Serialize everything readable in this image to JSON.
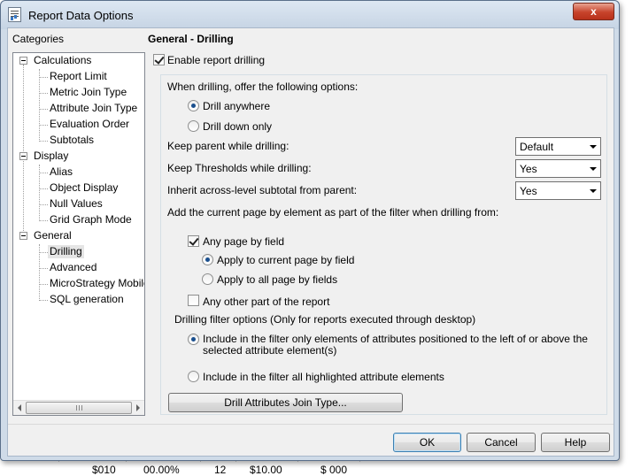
{
  "window": {
    "title": "Report Data Options",
    "close_label": "x"
  },
  "categories": {
    "label": "Categories",
    "groups": [
      {
        "label": "Calculations",
        "items": [
          "Report Limit",
          "Metric Join Type",
          "Attribute Join Type",
          "Evaluation Order",
          "Subtotals"
        ]
      },
      {
        "label": "Display",
        "items": [
          "Alias",
          "Object Display",
          "Null Values",
          "Grid Graph Mode"
        ]
      },
      {
        "label": "General",
        "items": [
          "Drilling",
          "Advanced",
          "MicroStrategy Mobile",
          "SQL generation"
        ]
      }
    ],
    "selected": "Drilling",
    "scroll_grip": "III"
  },
  "main": {
    "section_title": "General - Drilling",
    "enable_drilling": {
      "label": "Enable report drilling",
      "checked": true
    },
    "offer_options_label": "When drilling, offer the following options:",
    "drill_anywhere": {
      "label": "Drill anywhere",
      "selected": true
    },
    "drill_down_only": {
      "label": "Drill down only",
      "selected": false
    },
    "keep_parent": {
      "label": "Keep parent while drilling:",
      "value": "Default"
    },
    "keep_thresholds": {
      "label": "Keep Thresholds while drilling:",
      "value": "Yes"
    },
    "inherit_subtotal": {
      "label": "Inherit across-level subtotal from parent:",
      "value": "Yes"
    },
    "add_page_label": "Add the current page by element as part of the filter when drilling from:",
    "any_page_by_field": {
      "label": "Any page by field",
      "checked": true
    },
    "apply_current": {
      "label": "Apply to current page by field",
      "selected": true
    },
    "apply_all": {
      "label": "Apply to all page by fields",
      "selected": false
    },
    "any_other_part": {
      "label": "Any other part of the report",
      "checked": false
    },
    "filter_options_label": "Drilling filter options (Only for reports executed through desktop)",
    "include_left_above": {
      "label": "Include in the filter only elements of attributes positioned to the left of or above the selected attribute element(s)",
      "selected": true
    },
    "include_highlighted": {
      "label": "Include in the filter all highlighted attribute elements",
      "selected": false
    },
    "drill_join_button": "Drill Attributes Join Type..."
  },
  "footer": {
    "ok": "OK",
    "cancel": "Cancel",
    "help": "Help"
  },
  "background": {
    "cells": [
      "$010",
      "00.00%",
      "12",
      "$10.00",
      "$ 000"
    ]
  }
}
